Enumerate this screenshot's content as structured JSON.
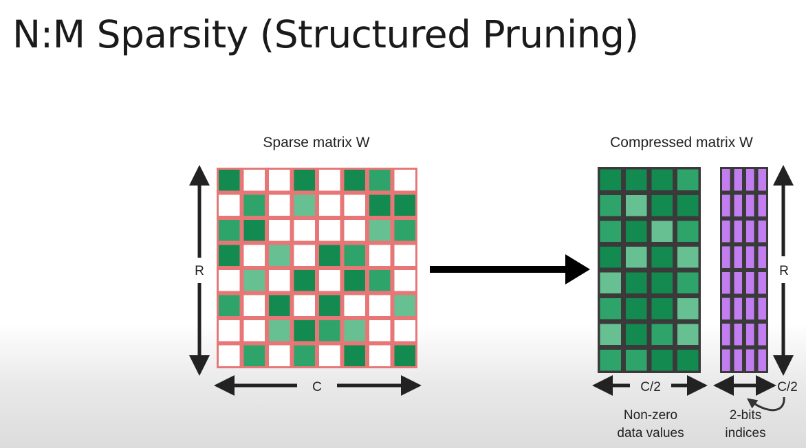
{
  "title": "N:M Sparsity (Structured Pruning)",
  "sparse": {
    "label": "Sparse matrix W",
    "row_label": "R",
    "col_label": "C",
    "cells": [
      [
        3,
        0,
        0,
        3,
        0,
        3,
        2,
        0
      ],
      [
        0,
        2,
        0,
        1,
        0,
        0,
        3,
        3
      ],
      [
        2,
        3,
        0,
        0,
        0,
        0,
        1,
        2
      ],
      [
        3,
        0,
        1,
        0,
        3,
        2,
        0,
        0
      ],
      [
        0,
        1,
        0,
        3,
        0,
        3,
        2,
        0
      ],
      [
        2,
        0,
        3,
        0,
        3,
        0,
        0,
        1
      ],
      [
        0,
        0,
        1,
        3,
        2,
        1,
        0,
        0
      ],
      [
        0,
        2,
        0,
        2,
        0,
        3,
        0,
        3
      ]
    ]
  },
  "compressed": {
    "label": "Compressed matrix W",
    "row_label": "R",
    "values_col_label": "C/2",
    "indices_col_label": "C/2",
    "values_caption": [
      "Non-zero",
      "data values"
    ],
    "indices_caption": [
      "2-bits",
      "indices"
    ],
    "cells": [
      [
        3,
        3,
        3,
        2
      ],
      [
        2,
        1,
        3,
        3
      ],
      [
        2,
        3,
        1,
        2
      ],
      [
        3,
        1,
        3,
        1
      ],
      [
        1,
        3,
        3,
        2
      ],
      [
        2,
        3,
        3,
        1
      ],
      [
        1,
        3,
        2,
        1
      ],
      [
        2,
        2,
        3,
        3
      ]
    ]
  },
  "colors": {
    "green_dark": "#138a4f",
    "green_mid": "#2fa46a",
    "green_light": "#66c092",
    "sparse_grid": "#e77777",
    "compressed_grid": "#3a3a3a",
    "index_fill": "#c27ef0"
  }
}
